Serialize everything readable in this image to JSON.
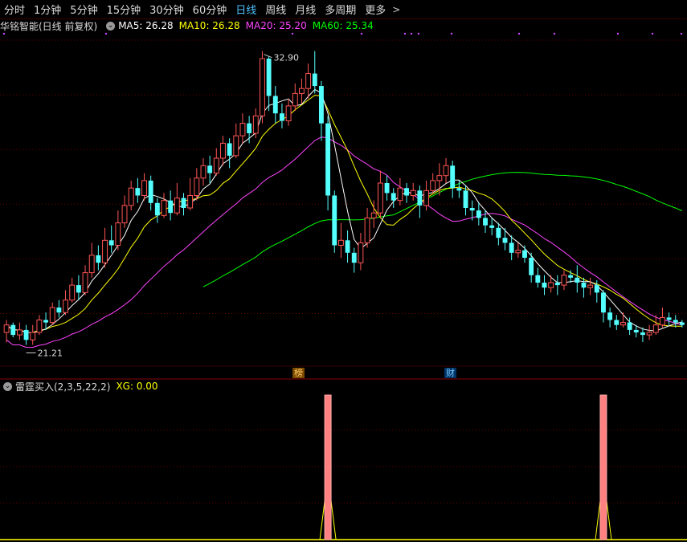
{
  "tabs": [
    {
      "label": "分时"
    },
    {
      "label": "1分钟"
    },
    {
      "label": "5分钟"
    },
    {
      "label": "15分钟"
    },
    {
      "label": "30分钟"
    },
    {
      "label": "60分钟"
    },
    {
      "label": "日线",
      "active": true
    },
    {
      "label": "周线"
    },
    {
      "label": "月线"
    },
    {
      "label": "多周期"
    },
    {
      "label": "更多"
    }
  ],
  "main_indicator": {
    "title": "华铭智能(日线 前复权)",
    "ma5": "MA5: 26.28",
    "ma10": "MA10: 26.28",
    "ma20": "MA20: 25.20",
    "ma60": "MA60: 25.34"
  },
  "sub_indicator": {
    "title": "雷霆买入(2,3,5,22,2)",
    "xg": "XG: 0.00"
  },
  "markers": {
    "bang": "榜",
    "cai": "财"
  },
  "colors": {
    "up": "#ff5555",
    "down": "#54ffff",
    "ma5": "#ffffff",
    "ma10": "#ffff00",
    "ma20": "#ff44ff",
    "ma60": "#00ff00",
    "grid": "#6a0000",
    "active_tab": "#4ec0ff"
  },
  "chart_data": {
    "type": "candlestick",
    "high_label": "32.90",
    "low_label": "21.21",
    "y_high": 32.9,
    "y_low": 21.21,
    "candles": [
      [
        21.6,
        21.9,
        21.2,
        22.1
      ],
      [
        21.9,
        21.5,
        21.4,
        22.0
      ],
      [
        21.5,
        21.7,
        21.3,
        22.0
      ],
      [
        21.7,
        21.3,
        21.1,
        21.9
      ],
      [
        21.3,
        21.6,
        21.1,
        21.9
      ],
      [
        21.6,
        22.1,
        21.5,
        22.3
      ],
      [
        22.1,
        22.0,
        21.7,
        22.4
      ],
      [
        22.0,
        22.6,
        21.9,
        22.8
      ],
      [
        22.6,
        22.4,
        22.2,
        22.9
      ],
      [
        22.4,
        22.9,
        22.3,
        23.3
      ],
      [
        22.9,
        23.5,
        22.8,
        23.8
      ],
      [
        23.5,
        23.2,
        22.9,
        23.9
      ],
      [
        23.2,
        24.0,
        23.1,
        24.3
      ],
      [
        24.0,
        24.7,
        23.8,
        25.2
      ],
      [
        24.7,
        24.4,
        24.1,
        25.1
      ],
      [
        24.4,
        25.3,
        24.2,
        25.8
      ],
      [
        25.3,
        25.1,
        24.8,
        25.9
      ],
      [
        25.1,
        26.0,
        24.9,
        26.5
      ],
      [
        26.0,
        26.7,
        25.8,
        27.1
      ],
      [
        26.7,
        27.4,
        26.5,
        27.7
      ],
      [
        27.4,
        27.1,
        26.8,
        27.8
      ],
      [
        27.1,
        27.7,
        26.9,
        28.0
      ],
      [
        27.7,
        26.8,
        26.5,
        27.9
      ],
      [
        26.8,
        26.3,
        26.0,
        27.0
      ],
      [
        26.3,
        26.9,
        26.2,
        27.2
      ],
      [
        26.9,
        26.4,
        26.1,
        27.3
      ],
      [
        26.4,
        27.0,
        26.3,
        27.6
      ],
      [
        27.0,
        26.6,
        26.3,
        27.2
      ],
      [
        26.6,
        27.1,
        26.5,
        27.8
      ],
      [
        27.1,
        27.8,
        26.9,
        28.2
      ],
      [
        27.8,
        28.3,
        27.5,
        28.6
      ],
      [
        28.3,
        28.0,
        27.6,
        28.7
      ],
      [
        28.0,
        28.6,
        27.9,
        29.0
      ],
      [
        28.6,
        29.2,
        28.3,
        29.5
      ],
      [
        29.2,
        28.7,
        28.2,
        29.4
      ],
      [
        28.7,
        29.5,
        28.6,
        30.0
      ],
      [
        29.5,
        30.0,
        29.2,
        30.4
      ],
      [
        30.0,
        29.6,
        29.2,
        30.3
      ],
      [
        29.6,
        30.3,
        29.4,
        30.6
      ],
      [
        30.3,
        32.6,
        30.0,
        32.9
      ],
      [
        32.6,
        31.1,
        30.5,
        32.7
      ],
      [
        31.1,
        30.4,
        30.0,
        31.5
      ],
      [
        30.4,
        30.1,
        29.8,
        30.8
      ],
      [
        30.1,
        30.7,
        29.9,
        31.0
      ],
      [
        30.7,
        31.2,
        30.5,
        31.6
      ],
      [
        31.2,
        31.4,
        30.8,
        31.8
      ],
      [
        31.4,
        32.0,
        31.0,
        32.4
      ],
      [
        32.0,
        31.5,
        31.2,
        32.9
      ],
      [
        31.5,
        30.0,
        29.3,
        31.7
      ],
      [
        30.0,
        27.1,
        26.5,
        30.3
      ],
      [
        27.1,
        25.1,
        24.8,
        27.3
      ],
      [
        25.1,
        25.3,
        24.6,
        26.0
      ],
      [
        25.3,
        24.8,
        24.4,
        25.7
      ],
      [
        24.8,
        24.4,
        24.0,
        25.0
      ],
      [
        24.4,
        25.2,
        24.1,
        25.6
      ],
      [
        25.2,
        26.2,
        25.0,
        26.6
      ],
      [
        26.2,
        26.4,
        25.8,
        26.9
      ],
      [
        26.4,
        27.6,
        26.2,
        28.1
      ],
      [
        27.6,
        27.2,
        26.9,
        27.9
      ],
      [
        27.2,
        26.9,
        26.6,
        27.4
      ],
      [
        26.9,
        27.4,
        26.7,
        27.8
      ],
      [
        27.4,
        27.1,
        26.8,
        27.6
      ],
      [
        27.1,
        27.3,
        26.9,
        27.6
      ],
      [
        27.3,
        26.7,
        26.2,
        27.5
      ],
      [
        26.7,
        27.3,
        26.5,
        27.7
      ],
      [
        27.3,
        27.7,
        27.2,
        28.0
      ],
      [
        27.7,
        27.9,
        27.1,
        28.4
      ],
      [
        27.9,
        28.3,
        27.6,
        28.6
      ],
      [
        28.3,
        27.4,
        27.0,
        28.5
      ],
      [
        27.4,
        27.3,
        27.0,
        27.7
      ],
      [
        27.3,
        26.6,
        26.3,
        27.5
      ],
      [
        26.6,
        26.5,
        26.1,
        26.9
      ],
      [
        26.5,
        26.2,
        25.9,
        26.8
      ],
      [
        26.2,
        25.9,
        25.6,
        26.5
      ],
      [
        25.9,
        25.8,
        25.5,
        26.2
      ],
      [
        25.8,
        25.4,
        25.1,
        26.0
      ],
      [
        25.4,
        25.2,
        24.9,
        25.8
      ],
      [
        25.2,
        24.8,
        24.5,
        25.5
      ],
      [
        24.8,
        24.9,
        24.6,
        25.2
      ],
      [
        24.9,
        24.6,
        24.4,
        25.1
      ],
      [
        24.6,
        23.9,
        23.6,
        24.8
      ],
      [
        23.9,
        23.6,
        23.4,
        24.2
      ],
      [
        23.6,
        23.4,
        23.1,
        23.9
      ],
      [
        23.4,
        23.6,
        23.2,
        23.9
      ],
      [
        23.6,
        23.5,
        23.1,
        23.9
      ],
      [
        23.5,
        23.9,
        23.3,
        24.1
      ],
      [
        23.9,
        23.8,
        23.6,
        24.1
      ],
      [
        23.8,
        23.6,
        23.2,
        24.3
      ],
      [
        23.6,
        23.4,
        23.0,
        23.8
      ],
      [
        23.4,
        23.5,
        23.1,
        23.8
      ],
      [
        23.5,
        23.2,
        22.8,
        23.7
      ],
      [
        23.2,
        22.4,
        22.0,
        23.3
      ],
      [
        22.4,
        22.1,
        21.8,
        22.6
      ],
      [
        22.1,
        21.9,
        21.7,
        22.3
      ],
      [
        21.9,
        22.0,
        21.8,
        22.4
      ],
      [
        22.0,
        21.7,
        21.5,
        22.2
      ],
      [
        21.7,
        21.6,
        21.4,
        21.9
      ],
      [
        21.6,
        21.5,
        21.21,
        21.8
      ],
      [
        21.5,
        21.6,
        21.3,
        21.9
      ],
      [
        21.6,
        21.9,
        21.5,
        22.3
      ],
      [
        21.9,
        22.2,
        21.8,
        22.6
      ],
      [
        22.2,
        22.1,
        21.9,
        22.4
      ],
      [
        22.1,
        22.0,
        21.8,
        22.3
      ],
      [
        22.0,
        21.9,
        21.8,
        22.1
      ]
    ],
    "ma60_start_index": 30,
    "signals": [
      {
        "index": 49,
        "value": 1
      },
      {
        "index": 91,
        "value": 1
      }
    ]
  }
}
